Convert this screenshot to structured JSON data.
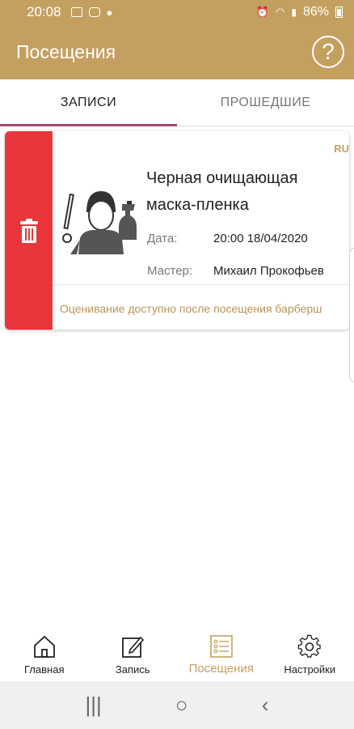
{
  "status_bar": {
    "time": "20:08",
    "battery": "86%"
  },
  "app_bar": {
    "title": "Посещения",
    "help_symbol": "?"
  },
  "tabs": [
    {
      "label": "ЗАПИСИ",
      "active": true
    },
    {
      "label": "ПРОШЕДШИЕ",
      "active": false
    }
  ],
  "appointment": {
    "lang_tag": "RU",
    "service": "Черная очищающая маска-пленка",
    "date_label": "Дата:",
    "date_value": "20:00  18/04/2020",
    "master_label": "Мастер:",
    "master_value": "Михаил Прокофьев",
    "note": "Оценивание доступно после посещения барберш"
  },
  "bottom_nav": [
    {
      "label": "Главная",
      "icon": "home-icon",
      "active": false
    },
    {
      "label": "Запись",
      "icon": "edit-icon",
      "active": false
    },
    {
      "label": "Посещения",
      "icon": "list-icon",
      "active": true
    },
    {
      "label": "Настройки",
      "icon": "gear-icon",
      "active": false
    }
  ],
  "system_nav": {
    "recents": "|||",
    "home": "○",
    "back": "‹"
  },
  "colors": {
    "brand": "#c4a060",
    "delete": "#e8363a",
    "tab_indicator": "#a34a73"
  }
}
